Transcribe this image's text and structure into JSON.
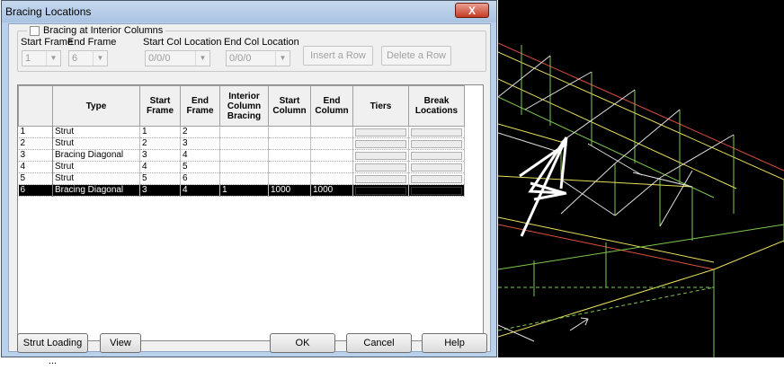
{
  "dialog": {
    "title": "Bracing Locations",
    "close_label": "X"
  },
  "options": {
    "checkbox_label": "Bracing at Interior Columns",
    "start_frame_label": "Start Frame",
    "start_frame_value": "1",
    "end_frame_label": "End Frame",
    "end_frame_value": "6",
    "start_col_label": "Start Col Location",
    "start_col_value": "0/0/0",
    "end_col_label": "End Col Location",
    "end_col_value": "0/0/0",
    "insert_row_label": "Insert a Row",
    "delete_row_label": "Delete a Row"
  },
  "grid": {
    "columns": [
      "",
      "Type",
      "Start Frame",
      "End Frame",
      "Interior Column Bracing",
      "Start Column",
      "End Column",
      "Tiers",
      "Break Locations"
    ],
    "rows": [
      {
        "num": "1",
        "type": "Strut",
        "start": "1",
        "end": "2",
        "interior": "",
        "start_col": "",
        "end_col": ""
      },
      {
        "num": "2",
        "type": "Strut",
        "start": "2",
        "end": "3",
        "interior": "",
        "start_col": "",
        "end_col": ""
      },
      {
        "num": "3",
        "type": "Bracing Diagonal",
        "start": "3",
        "end": "4",
        "interior": "",
        "start_col": "",
        "end_col": ""
      },
      {
        "num": "4",
        "type": "Strut",
        "start": "4",
        "end": "5",
        "interior": "",
        "start_col": "",
        "end_col": ""
      },
      {
        "num": "5",
        "type": "Strut",
        "start": "5",
        "end": "6",
        "interior": "",
        "start_col": "",
        "end_col": ""
      },
      {
        "num": "6",
        "type": "Bracing Diagonal",
        "start": "3",
        "end": "4",
        "interior": "1",
        "start_col": "1000",
        "end_col": "1000"
      }
    ],
    "selected_row": 6
  },
  "footer": {
    "strut_loading_label": "Strut Loading ...",
    "view_label": "View",
    "ok_label": "OK",
    "cancel_label": "Cancel",
    "help_label": "Help"
  },
  "colors": {
    "title_bar": "#b9d1ea",
    "close_button": "#c43c24",
    "viewport_bg": "#000000",
    "wire_green": "#7ec850",
    "wire_yellow": "#e8e05a",
    "wire_red": "#e05040",
    "bracing_white": "#ffffff"
  }
}
